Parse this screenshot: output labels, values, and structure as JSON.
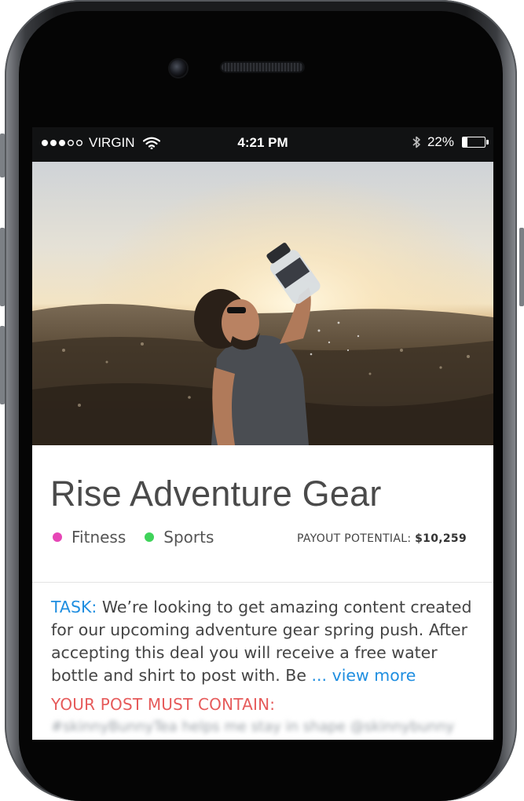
{
  "status_bar": {
    "carrier": "VIRGIN",
    "time": "4:21 PM",
    "battery": "22%",
    "battery_level": 0.22,
    "signal_bars_filled": 3,
    "signal_bars_total": 5,
    "icons": [
      "signal-dots-icon",
      "wifi-icon",
      "bluetooth-icon",
      "battery-icon"
    ]
  },
  "hero": {
    "image": "man-drinking-from-water-bottle-photo"
  },
  "campaign": {
    "title": "Rise Adventure Gear",
    "tags": [
      {
        "label": "Fitness",
        "color": "#e646b6"
      },
      {
        "label": "Sports",
        "color": "#3fd35a"
      }
    ],
    "payout_label": "PAYOUT POTENTIAL:",
    "payout_value": "$10,259",
    "task_label": "TASK:",
    "task_text": " We’re looking to get amazing content created for our upcoming adventure gear spring push. After accepting this deal you will receive a free water bottle and shirt to post with. Be ",
    "view_more": "... view more",
    "must_contain_label": "YOUR POST MUST CONTAIN:",
    "must_contain_blurred": "#skinnyBunnyTea helps me stay in shape @skinnybunny"
  },
  "colors": {
    "accent_blue": "#1f8ee0",
    "warning_red": "#e65a5a",
    "title_gray": "#4a4a4a"
  }
}
